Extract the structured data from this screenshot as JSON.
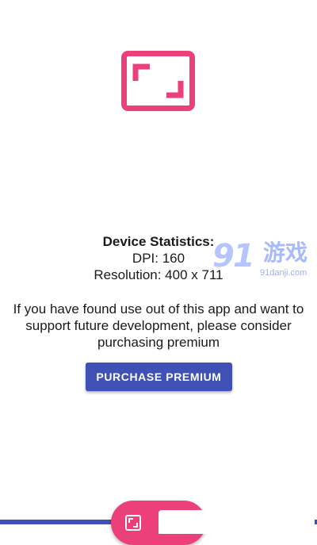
{
  "app": {
    "icon_name": "fullscreen-frame-icon",
    "accent_color": "#ec407a"
  },
  "stats": {
    "title": "Device Statistics:",
    "dpi": "DPI: 160",
    "resolution": "Resolution: 400 x 711"
  },
  "support": {
    "message": "If you have found use out of this app and want to support future development, please consider purchasing premium",
    "purchase_label": "PURCHASE PREMIUM",
    "button_color": "#3f51b5"
  },
  "watermark": {
    "logo": "91",
    "chinese": "游戏",
    "url": "91danji.com"
  },
  "fab": {
    "icon_name": "fullscreen-icon"
  }
}
